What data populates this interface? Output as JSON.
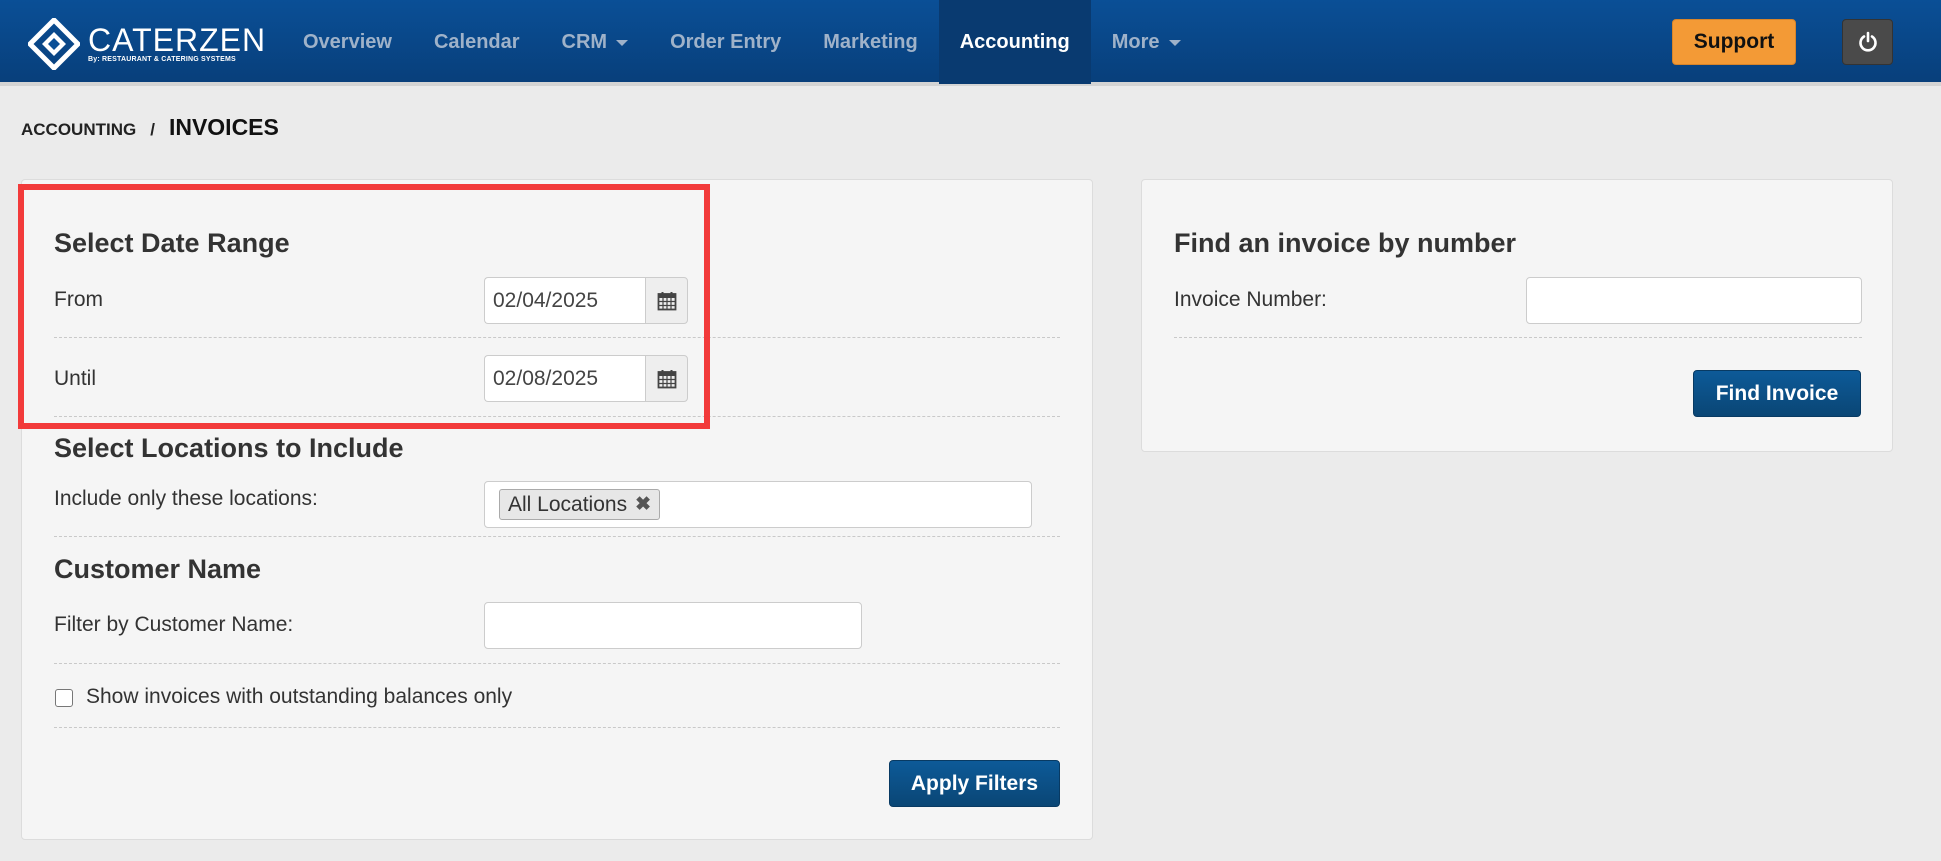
{
  "brand": {
    "name": "CATERZEN",
    "tagline": "By: RESTAURANT & CATERING SYSTEMS"
  },
  "nav": {
    "items": [
      {
        "label": "Overview"
      },
      {
        "label": "Calendar"
      },
      {
        "label": "CRM"
      },
      {
        "label": "Order Entry"
      },
      {
        "label": "Marketing"
      },
      {
        "label": "Accounting"
      },
      {
        "label": "More"
      }
    ],
    "active": "Accounting",
    "support_label": "Support",
    "power_icon": "power-icon"
  },
  "breadcrumb": {
    "parent": "ACCOUNTING",
    "separator": "/",
    "current": "INVOICES"
  },
  "filters": {
    "date_range": {
      "title": "Select Date Range",
      "from_label": "From",
      "from_value": "02/04/2025",
      "until_label": "Until",
      "until_value": "02/08/2025",
      "calendar_icon": "calendar-icon"
    },
    "locations": {
      "title": "Select Locations to Include",
      "label": "Include only these locations:",
      "selected_tag": "All Locations",
      "remove_glyph": "✖"
    },
    "customer": {
      "title": "Customer Name",
      "label": "Filter by Customer Name:",
      "value": ""
    },
    "outstanding": {
      "label": "Show invoices with outstanding balances only",
      "checked": false
    },
    "apply_label": "Apply Filters"
  },
  "find_invoice": {
    "title": "Find an invoice by number",
    "label": "Invoice Number:",
    "value": "",
    "button_label": "Find Invoice"
  },
  "colors": {
    "navbar": "#0a4f96",
    "support": "#f39a36",
    "primary_button": "#0d5a98",
    "highlight": "#f23a3a"
  }
}
